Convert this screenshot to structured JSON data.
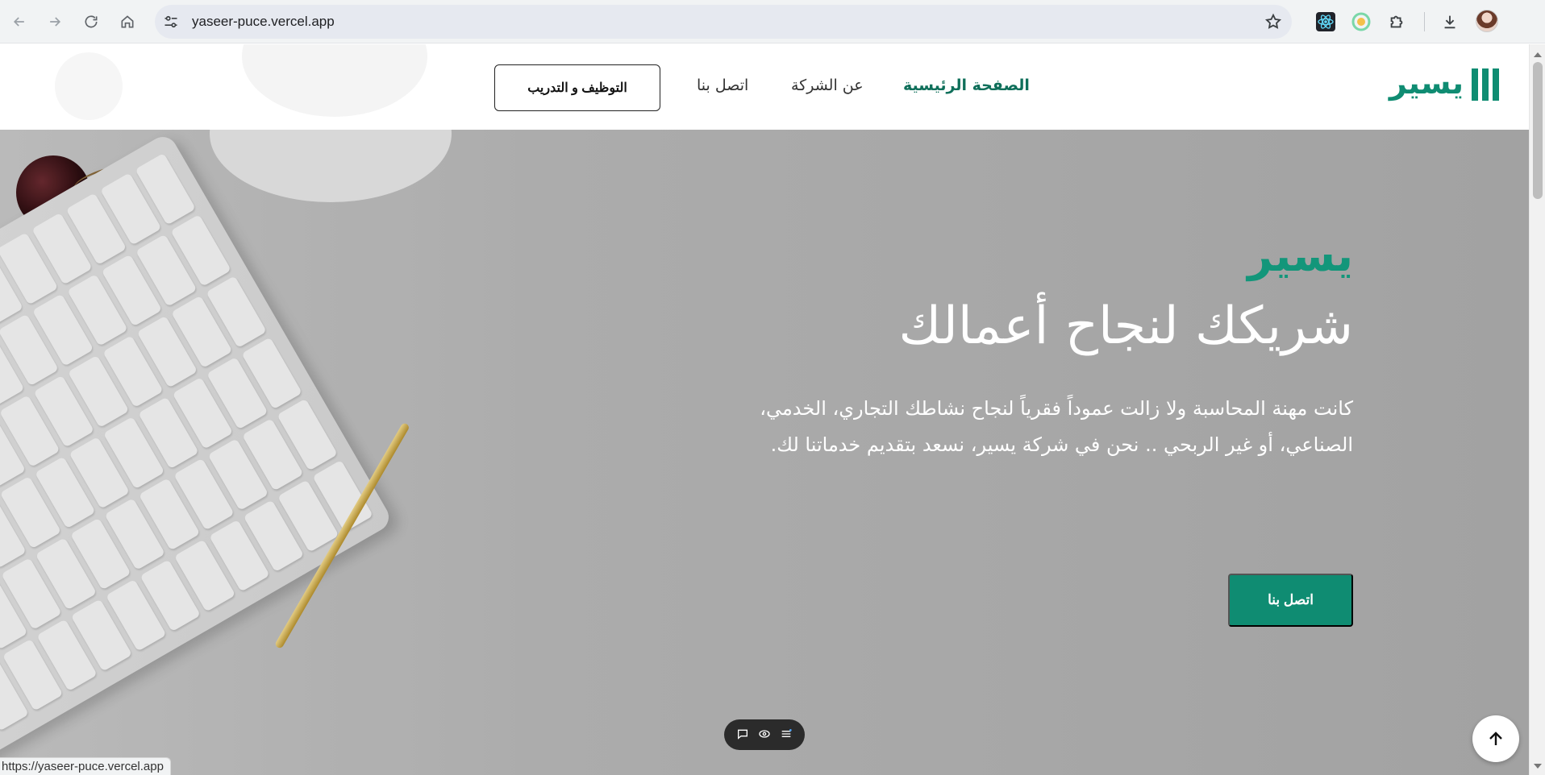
{
  "browser": {
    "url": "yaseer-puce.vercel.app",
    "status_url": "https://yaseer-puce.vercel.app",
    "icons": [
      "back-icon",
      "forward-icon",
      "reload-icon",
      "home-icon",
      "site-settings-icon",
      "star-icon",
      "react-devtools-icon",
      "extension-color-icon",
      "extensions-puzzle-icon",
      "download-icon",
      "profile-avatar"
    ]
  },
  "header": {
    "logo_text": "يسير",
    "nav": {
      "home": "الصفحة الرئيسية",
      "about": "عن الشركة",
      "contact": "اتصل بنا"
    },
    "careers_button": "التوظيف و التدريب"
  },
  "hero": {
    "brand": "يسير",
    "title": "شريكك لنجاح أعمالك",
    "description_line1": "كانت مهنة المحاسبة ولا زالت عموداً فقرياً لنجاح نشاطك التجاري، الخدمي،",
    "description_line2": "الصناعي، أو غير الربحي .. نحن في شركة يسير، نسعد بتقديم خدماتنا لك.",
    "cta": "اتصل بنا"
  },
  "colors": {
    "brand_green": "#0f8c72",
    "brand_green_dark": "#0f6f5a"
  }
}
